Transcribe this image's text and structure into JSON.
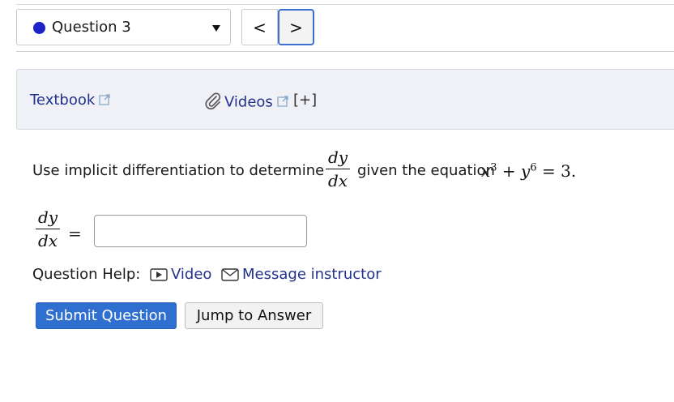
{
  "question_nav": {
    "selected": "Question 3",
    "status_color": "#1d22c9",
    "prev_label": "<",
    "next_label": ">"
  },
  "help_links": {
    "textbook": "Textbook",
    "videos": "Videos",
    "expand": "[+]",
    "link_color": "#22318a"
  },
  "question": {
    "prompt_before": "Use implicit differentiation to determine",
    "derivative_num": "dy",
    "derivative_den": "dx",
    "prompt_after": "given the equation",
    "eq_x": "x",
    "eq_x_power": "3",
    "eq_plus": "+",
    "eq_y": "y",
    "eq_y_power": "6",
    "eq_equals": "=",
    "eq_rhs": "3."
  },
  "answer": {
    "lhs_num": "dy",
    "lhs_den": "dx",
    "equals": "=",
    "value": ""
  },
  "question_help": {
    "label": "Question Help:",
    "video": "Video",
    "message": "Message instructor"
  },
  "actions": {
    "submit": "Submit Question",
    "jump": "Jump to Answer",
    "submit_color": "#2f6fd0"
  }
}
